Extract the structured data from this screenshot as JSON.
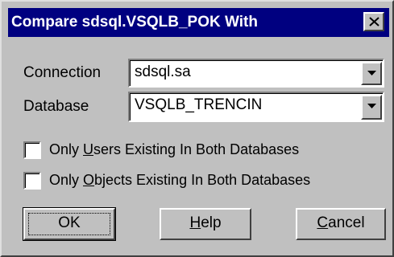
{
  "window": {
    "title": "Compare sdsql.VSQLB_POK With",
    "close_icon": "close-icon"
  },
  "connection": {
    "label": "Connection",
    "value": "sdsql.sa"
  },
  "database": {
    "label": "Database",
    "value": "VSQLB_TRENCIN"
  },
  "options": {
    "users_prefix": "Only ",
    "users_mnemonic": "U",
    "users_suffix": "sers Existing In Both Databases",
    "users_checked": false,
    "objects_prefix": "Only ",
    "objects_mnemonic": "O",
    "objects_suffix": "bjects Existing In Both Databases",
    "objects_checked": false
  },
  "buttons": {
    "ok": "OK",
    "help_mnemonic": "H",
    "help_rest": "elp",
    "cancel_mnemonic": "C",
    "cancel_rest": "ancel"
  }
}
